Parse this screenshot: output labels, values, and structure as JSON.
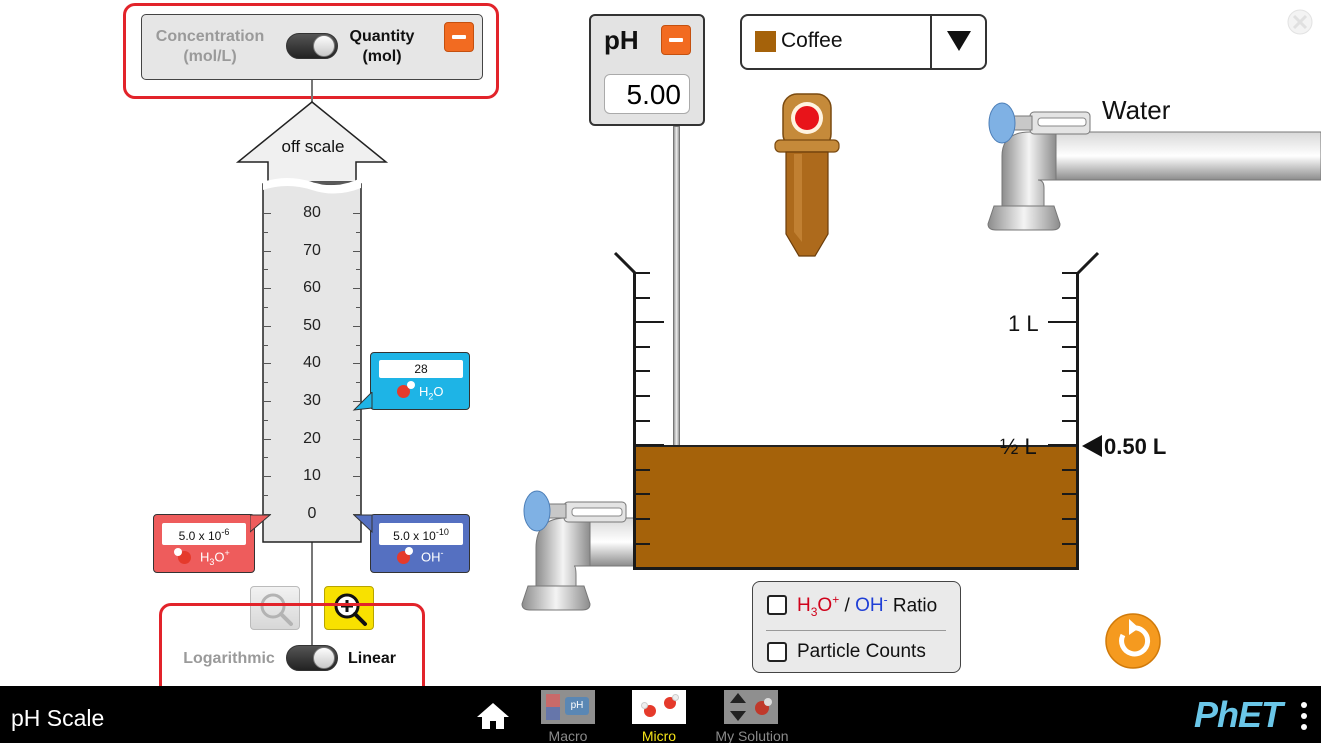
{
  "graph": {
    "mode_toggle": {
      "left_label_line1": "Concentration",
      "left_label_line2": "(mol/L)",
      "right_label_line1": "Quantity",
      "right_label_line2": "(mol)",
      "selected": "Quantity (mol)"
    },
    "off_scale_label": "off scale",
    "axis_ticks": [
      "80",
      "70",
      "60",
      "50",
      "40",
      "30",
      "20",
      "10",
      "0"
    ],
    "h2o_indicator": {
      "value": "28",
      "label_base": "H",
      "label_sub": "2",
      "label_end": "O",
      "color": "#1eb4e6"
    },
    "h3o_indicator": {
      "mantissa": "5.0 x 10",
      "exponent": "-6",
      "label_base": "H",
      "label_sub": "3",
      "label_mid": "O",
      "label_sup": "+",
      "color": "#ee5c5c"
    },
    "oh_indicator": {
      "mantissa": "5.0 x 10",
      "exponent": "-10",
      "label_base": "OH",
      "label_sup": "-",
      "color": "#5570c1"
    },
    "zoom_out_icon": "magnifier-minus-icon",
    "zoom_in_icon": "magnifier-plus-icon",
    "scale_toggle": {
      "left_label": "Logarithmic",
      "right_label": "Linear",
      "selected": "Linear"
    }
  },
  "ph_meter": {
    "title": "pH",
    "value": "5.00"
  },
  "solution_select": {
    "selected": "Coffee",
    "swatch_color": "#a5620a"
  },
  "water_faucet": {
    "label": "Water"
  },
  "beaker": {
    "label_1L": "1 L",
    "label_half": "½ L",
    "volume_readout": "0.50 L",
    "liquid_color": "#a5620a"
  },
  "checkboxes": {
    "ratio": {
      "h3o_base": "H",
      "h3o_sub": "3",
      "h3o_mid": "O",
      "h3o_sup": "+",
      "slash": "/",
      "oh_base": "OH",
      "oh_sup": "-",
      "suffix": "Ratio",
      "checked": false
    },
    "particle_counts": {
      "label": "Particle Counts",
      "checked": false
    }
  },
  "navbar": {
    "title": "pH Scale",
    "tabs": [
      {
        "label": "Macro",
        "active": false
      },
      {
        "label": "Micro",
        "active": true
      },
      {
        "label": "My Solution",
        "active": false
      }
    ],
    "brand": "PhET"
  },
  "colors": {
    "accent_orange": "#f26b21",
    "highlight_red": "#e2232a",
    "phet_blue": "#6ac6e8",
    "active_tab": "#f5e318"
  }
}
